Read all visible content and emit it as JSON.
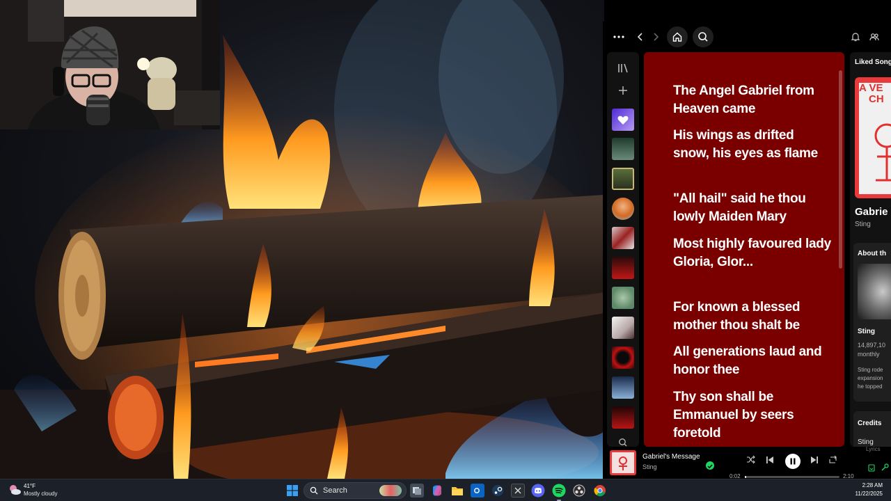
{
  "spotify": {
    "topbar": {
      "more_icon": "more-dots-icon",
      "back_icon": "chevron-left-icon",
      "forward_icon": "chevron-right-icon",
      "home_icon": "home-icon",
      "search_icon": "search-icon",
      "bell_icon": "bell-icon",
      "friends_icon": "friends-icon"
    },
    "sidebar": {
      "library_icon": "library-icon",
      "add_icon": "plus-icon",
      "search_icon": "search-icon"
    },
    "lyrics": [
      "The Angel Gabriel from Heaven came",
      "His wings as drifted snow, his eyes as flame",
      "\"All hail\" said he thou lowly Maiden Mary",
      "Most highly favoured lady Gloria, Glor...",
      "For known a blessed mother thou shalt be",
      "All generations laud and honor thee",
      "Thy son shall be Emmanuel by seers foretold"
    ],
    "now_playing_view": {
      "playlist": "Liked Songs",
      "cover_text_1": "A VE",
      "cover_text_2": "CH",
      "track_title": "Gabrie",
      "artist": "Sting",
      "about_label": "About th",
      "about_artist": "Sting",
      "listeners": "14,897,10",
      "listeners_suffix": "monthly",
      "bio_1": "Sting rode",
      "bio_2": "expansion",
      "bio_3": "he topped",
      "credits_label": "Credits",
      "credits_artist": "Sting"
    },
    "player": {
      "track": "Gabriel's Message",
      "artist": "Sting",
      "elapsed": "0:02",
      "duration": "2:10",
      "progress_fraction": 0.015,
      "lyrics_label": "Lyrics"
    }
  },
  "taskbar": {
    "weather_temp": "41°F",
    "weather_desc": "Mostly cloudy",
    "search_label": "Search",
    "time": "2:28 AM",
    "date": "11/22/2025"
  },
  "colors": {
    "lyrics_bg": "#7a0000",
    "spotify_green": "#1ed760",
    "taskbar_bg": "#1c2129"
  }
}
